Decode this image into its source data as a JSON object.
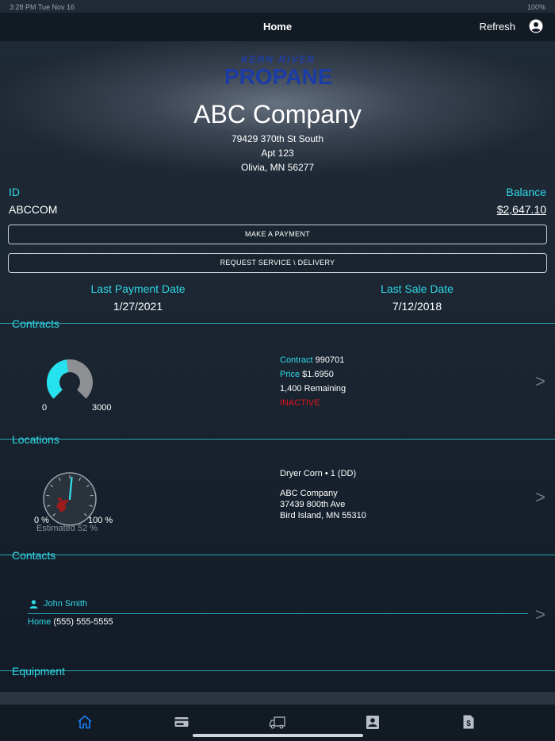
{
  "status": {
    "time": "3:28 PM  Tue Nov 16",
    "battery": "100%"
  },
  "nav": {
    "title": "Home",
    "refresh": "Refresh"
  },
  "logo": {
    "top": "KERN RIVER",
    "main": "PROPANE"
  },
  "company": {
    "name": "ABC Company",
    "address_lines": [
      "79429 370th St South",
      "Apt 123",
      "Olivia, MN 56277"
    ]
  },
  "account": {
    "id_label": "ID",
    "id_value": "ABCCOM",
    "balance_label": "Balance",
    "balance_value": "$2,647.10"
  },
  "buttons": {
    "payment": "MAKE A PAYMENT",
    "service": "REQUEST SERVICE \\ DELIVERY"
  },
  "dates": {
    "last_payment_label": "Last Payment Date",
    "last_payment_value": "1/27/2021",
    "last_sale_label": "Last Sale Date",
    "last_sale_value": "7/12/2018"
  },
  "contracts": {
    "title": "Contracts",
    "gauge_min": "0",
    "gauge_max": "3000",
    "gauge_fraction": 0.47,
    "contract_label": "Contract",
    "contract_value": "990701",
    "price_label": "Price",
    "price_value": "$1.6950",
    "remaining": "1,400 Remaining",
    "status": "INACTIVE"
  },
  "locations": {
    "title": "Locations",
    "gauge_min": "0 %",
    "gauge_max": "100 %",
    "estimated": "Estimated 52 %",
    "estimated_percent": 52,
    "tank": "Dryer Corn • 1 (DD)",
    "lines": [
      "ABC Company",
      "37439 800th Ave",
      "Bird Island, MN  55310"
    ]
  },
  "contacts": {
    "title": "Contacts",
    "name": "John Smith",
    "phone_label": "Home",
    "phone_value": "(555) 555-5555"
  },
  "equipment": {
    "title": "Equipment"
  },
  "tabs": [
    "home-icon",
    "card-icon",
    "truck-icon",
    "contacts-icon",
    "invoice-icon"
  ],
  "colors": {
    "accent": "#2fd8e6",
    "inactive": "#e0141c",
    "active_tab": "#1a7cf5"
  }
}
